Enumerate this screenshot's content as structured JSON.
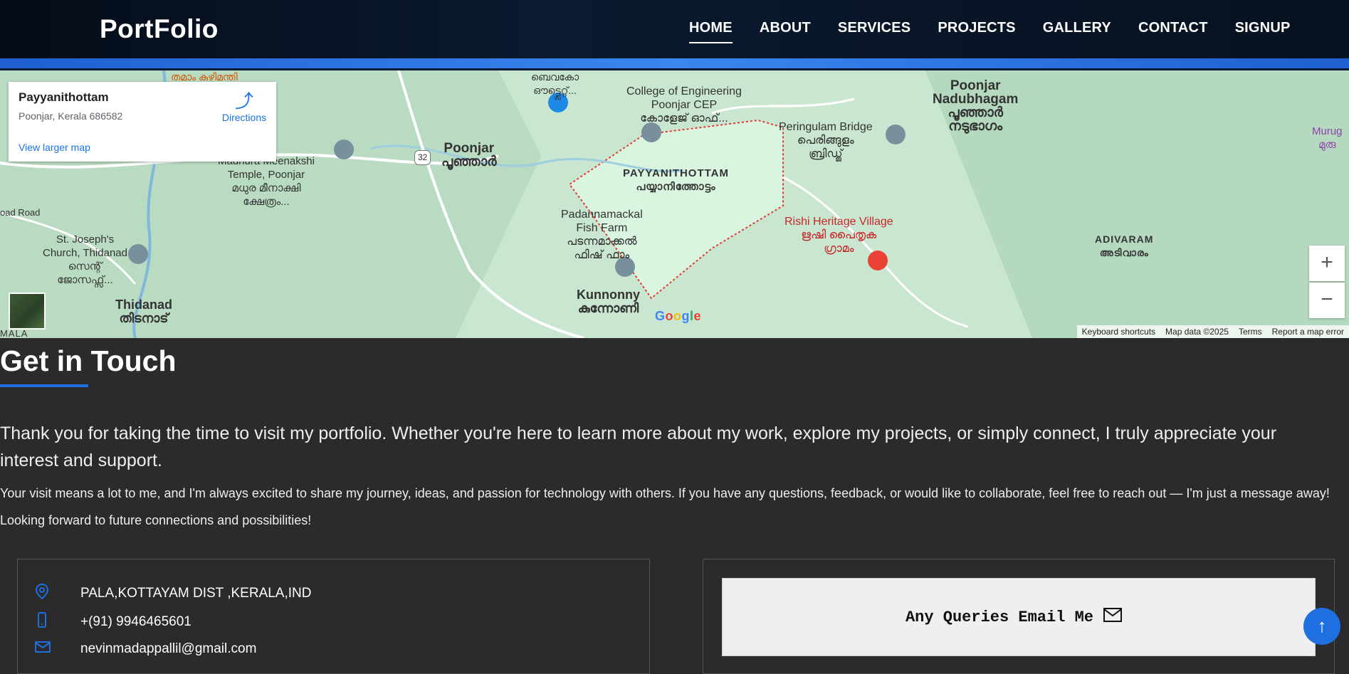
{
  "brand": "PortFolio",
  "nav": {
    "items": [
      "HOME",
      "ABOUT",
      "SERVICES",
      "PROJECTS",
      "GALLERY",
      "CONTACT",
      "SIGNUP"
    ]
  },
  "map": {
    "card_title": "Payyanithottam",
    "card_address": "Poonjar, Kerala 686582",
    "card_link": "View larger map",
    "directions": "Directions",
    "labels": {
      "poonjar": "Poonjar\nപൂഞ്ഞാർ",
      "college": "College of Engineering\nPoonjar CEP\nകോളേജ് ഓഫ്...",
      "poonjar_nadu": "Poonjar\nNadubhagam\nപൂഞ്ഞാർ\nനടുഭാഗം",
      "peringulam": "Peringulam Bridge\nപെരിങ്ങുളം\nബ്രിഡ്ജ്",
      "payyani": "PAYYANITHOTTAM\nപയ്യാനിത്തോട്ടം",
      "madhura": "Madhura Meenakshi\nTemple, Poonjar\nമധുര മീനാക്ഷി\nക്ഷേത്രം...",
      "padanna": "Padannamackal\nFish Farm\nപടന്നമാക്കൽ\nഫിഷ് ഫാം",
      "rishi": "Rishi Heritage Village\nഋഷി പൈതൃക\nഗ്രാമം",
      "adivaram": "ADIVARAM\nഅടിവാരം",
      "stjoseph": "St. Joseph's\nChurch, Thidanad\nസെന്റ്\nജോസഫ്സ്...",
      "thidanad": "Thidanad\nതിടനാട്",
      "kunnonny": "Kunnonny\nകുന്നോണി",
      "murug": "Murug\nമുരു",
      "road": "oad Road",
      "bev": "ബെവകോ\nഔട്ട്ലെറ്റ്...",
      "thamam": "തമാം കുഴിമന്തി",
      "route": "32"
    },
    "mala": "MALA",
    "google": "Google",
    "attribution": [
      "Keyboard shortcuts",
      "Map data ©2025",
      "Terms",
      "Report a map error"
    ]
  },
  "contact": {
    "heading": "Get in Touch",
    "para1": "Thank you for taking the time to visit my portfolio. Whether you're here to learn more about my work, explore my projects, or simply connect, I truly appreciate your interest and support.",
    "para2": "Your visit means a lot to me, and I'm always excited to share my journey, ideas, and passion for technology with others. If you have any questions, feedback, or would like to collaborate, feel free to reach out — I'm just a message away!",
    "para3": "Looking forward to future connections and possibilities!",
    "address": "PALA,KOTTAYAM DIST ,KERALA,IND",
    "phone": "+(91) 9946465601",
    "email": "nevinmadappallil@gmail.com",
    "email_button": "Any Queries Email Me"
  },
  "icons": {
    "location": "location-pin-icon",
    "phone": "phone-icon",
    "mail": "mail-icon",
    "scroll_top": "arrow-up-icon"
  },
  "colors": {
    "accent": "#1f6fe0",
    "background": "#2b2b2b",
    "nav": "#07111f"
  }
}
